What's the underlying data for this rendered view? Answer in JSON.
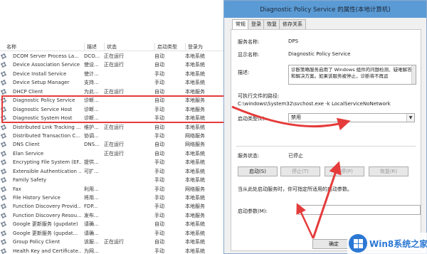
{
  "services": {
    "columns": [
      "名称",
      "描述",
      "状态",
      "启动类型",
      "登录为"
    ],
    "rows": [
      [
        "DCOM Server Process La...",
        "DCO...",
        "正在运行",
        "自动",
        "本地系统"
      ],
      [
        "Device Association Service",
        "使设...",
        "正在运行",
        "自动",
        "本地系统"
      ],
      [
        "Device Install Service",
        "使计...",
        "",
        "手动",
        "本地系统"
      ],
      [
        "Device Setup Manager",
        "支持...",
        "",
        "手动",
        "本地系统"
      ],
      [
        "DHCP Client",
        "为此...",
        "正在运行",
        "自动",
        "本地服务"
      ],
      [
        "Diagnostic Policy Service",
        "诊断...",
        "",
        "自动",
        "本地服务"
      ],
      [
        "Diagnostic Service Host",
        "诊断...",
        "",
        "手动",
        "本地服务"
      ],
      [
        "Diagnostic System Host",
        "诊断...",
        "",
        "手动",
        "本地系统"
      ],
      [
        "Distributed Link Tracking ...",
        "维护...",
        "正在运行",
        "自动",
        "本地系统"
      ],
      [
        "Distributed Transaction C...",
        "协调...",
        "",
        "手动",
        "网络服务"
      ],
      [
        "DNS Client",
        "DNS...",
        "正在运行",
        "自动",
        "网络服务"
      ],
      [
        "Elan Service",
        "",
        "正在运行",
        "自动",
        "本地系统"
      ],
      [
        "Encrypting File System (EF...",
        "提供...",
        "",
        "手动",
        "本地系统"
      ],
      [
        "Extensible Authentication ...",
        "可扩...",
        "",
        "手动",
        "本地系统"
      ],
      [
        "Family Safety",
        "",
        "",
        "手动",
        "本地系统"
      ],
      [
        "Fax",
        "利用...",
        "",
        "手动",
        "网络服务"
      ],
      [
        "File History Service",
        "将用...",
        "",
        "手动",
        "本地系统"
      ],
      [
        "Function Discovery Provid...",
        "FDP...",
        "",
        "手动",
        "本地服务"
      ],
      [
        "Function Discovery Resou...",
        "发布...",
        "",
        "手动",
        "本地服务"
      ],
      [
        "Google 更新服务 (gupdate)",
        "请确...",
        "",
        "自动",
        "本地系统"
      ],
      [
        "Google 更新服务 (gupdat...",
        "请确...",
        "",
        "手动",
        "本地系统"
      ],
      [
        "Group Policy Client",
        "该服...",
        "正在运行",
        "自动",
        "本地系统"
      ],
      [
        "Health Key and Certificate...",
        "为网...",
        "",
        "手动",
        "本地系统"
      ]
    ]
  },
  "dialog": {
    "title": "Diagnostic Policy Service 的属性(本地计算机)",
    "tabs": [
      "常规",
      "登录",
      "恢复",
      "依存关系"
    ],
    "service_name_label": "服务名称:",
    "service_name_value": "DPS",
    "display_name_label": "显示名称:",
    "display_name_value": "Diagnostic Policy Service",
    "description_label": "描述:",
    "description_text": "诊断策略服务启用了 Windows 组件的问题检测、疑难解答和解决方案。如果该服务被停止，诊断将不再运",
    "exe_path_label": "可执行文件的路径:",
    "exe_path_value": "C:\\windows\\System32\\svchost.exe -k LocalServiceNoNetwork",
    "startup_type_label": "启动类型(E):",
    "startup_type_value": "禁用",
    "service_status_label": "服务状态:",
    "service_status_value": "已停止",
    "buttons": {
      "start": "启动(S)",
      "stop": "停止(T)",
      "pause": "暂停(P)",
      "resume": "恢复(R)",
      "ok": "确定"
    },
    "hint_text": "当从此处启动服务时，你可指定所适用的启动参数。",
    "start_params_label": "启动参数(M):"
  },
  "watermark": {
    "text": "Win8系统之家"
  },
  "colors": {
    "highlight_red": "#e53b3b",
    "title_bar_blue": "#5b9bd5",
    "watermark_blue": "#2b78d4"
  }
}
